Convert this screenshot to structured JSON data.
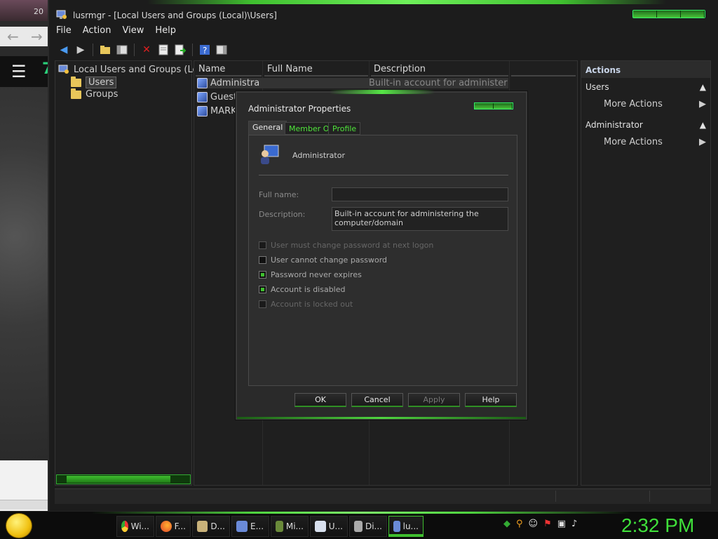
{
  "background": {
    "browser_number": "7",
    "back_arrow": "←",
    "forward_arrow": "→",
    "top_fragment": "20"
  },
  "window": {
    "title": "lusrmgr - [Local Users and Groups (Local)\\Users]",
    "menu": [
      "File",
      "Action",
      "View",
      "Help"
    ]
  },
  "tree": {
    "root": "Local Users and Groups (Loc",
    "items": [
      "Users",
      "Groups"
    ]
  },
  "list": {
    "columns": [
      "Name",
      "Full Name",
      "Description"
    ],
    "rows": [
      {
        "name": "Administra",
        "description": "Built-in account for administer"
      },
      {
        "name": "Guest",
        "description": ""
      },
      {
        "name": "MARK",
        "description": ""
      }
    ]
  },
  "actions": {
    "header": "Actions",
    "groups": [
      {
        "title": "Users",
        "item": "More Actions"
      },
      {
        "title": "Administrator",
        "item": "More Actions"
      }
    ]
  },
  "dialog": {
    "title": "Administrator Properties",
    "tabs": [
      "General",
      "Member Of",
      "Profile"
    ],
    "user_name": "Administrator",
    "full_name_label": "Full name:",
    "full_name_value": "",
    "description_label": "Description:",
    "description_value": "Built-in account for administering the computer/domain",
    "checkboxes": [
      {
        "label": "User must change password at next logon",
        "checked": false,
        "enabled": false
      },
      {
        "label": "User cannot change password",
        "checked": false,
        "enabled": true
      },
      {
        "label": "Password never expires",
        "checked": true,
        "enabled": true
      },
      {
        "label": "Account is disabled",
        "checked": true,
        "enabled": true
      },
      {
        "label": "Account is locked out",
        "checked": false,
        "enabled": false
      }
    ],
    "buttons": [
      "OK",
      "Cancel",
      "Apply",
      "Help"
    ]
  },
  "taskbar": {
    "tasks": [
      "Wi...",
      "F...",
      "D...",
      "E...",
      "Mi...",
      "U...",
      "Di...",
      "lu..."
    ],
    "clock": "2:32 PM",
    "colors": {
      "accent": "#3fbf2f",
      "clock": "#3fdf3a"
    }
  }
}
